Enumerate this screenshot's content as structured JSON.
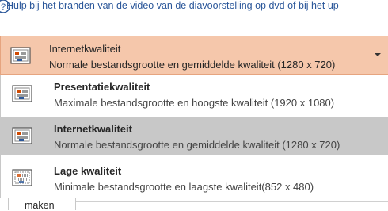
{
  "help": {
    "link_text": "Hulp bij het branden van de video van de diavoorstelling op dvd of bij het up"
  },
  "quality_dropdown": {
    "selected_title": "Internetkwaliteit",
    "selected_description": "Normale bestandsgrootte en gemiddelde kwaliteit (1280 x 720)"
  },
  "quality_options": [
    {
      "title": "Presentatiekwaliteit",
      "description": "Maximale bestandsgrootte en hoogste kwaliteit (1920 x 1080)",
      "selected": false,
      "icon": "presentation-quality-icon"
    },
    {
      "title": "Internetkwaliteit",
      "description": "Normale bestandsgrootte en gemiddelde kwaliteit (1280 x 720)",
      "selected": true,
      "icon": "internet-quality-icon"
    },
    {
      "title": "Lage kwaliteit",
      "description": "Minimale bestandsgrootte en laagste kwaliteit(852 x 480)",
      "selected": false,
      "icon": "low-quality-icon"
    }
  ],
  "bottom_tab": {
    "label": "maken"
  },
  "colors": {
    "dropdown_bg": "#f5c7ab",
    "selected_row_bg": "#c8c8c8",
    "link": "#2b579a"
  }
}
